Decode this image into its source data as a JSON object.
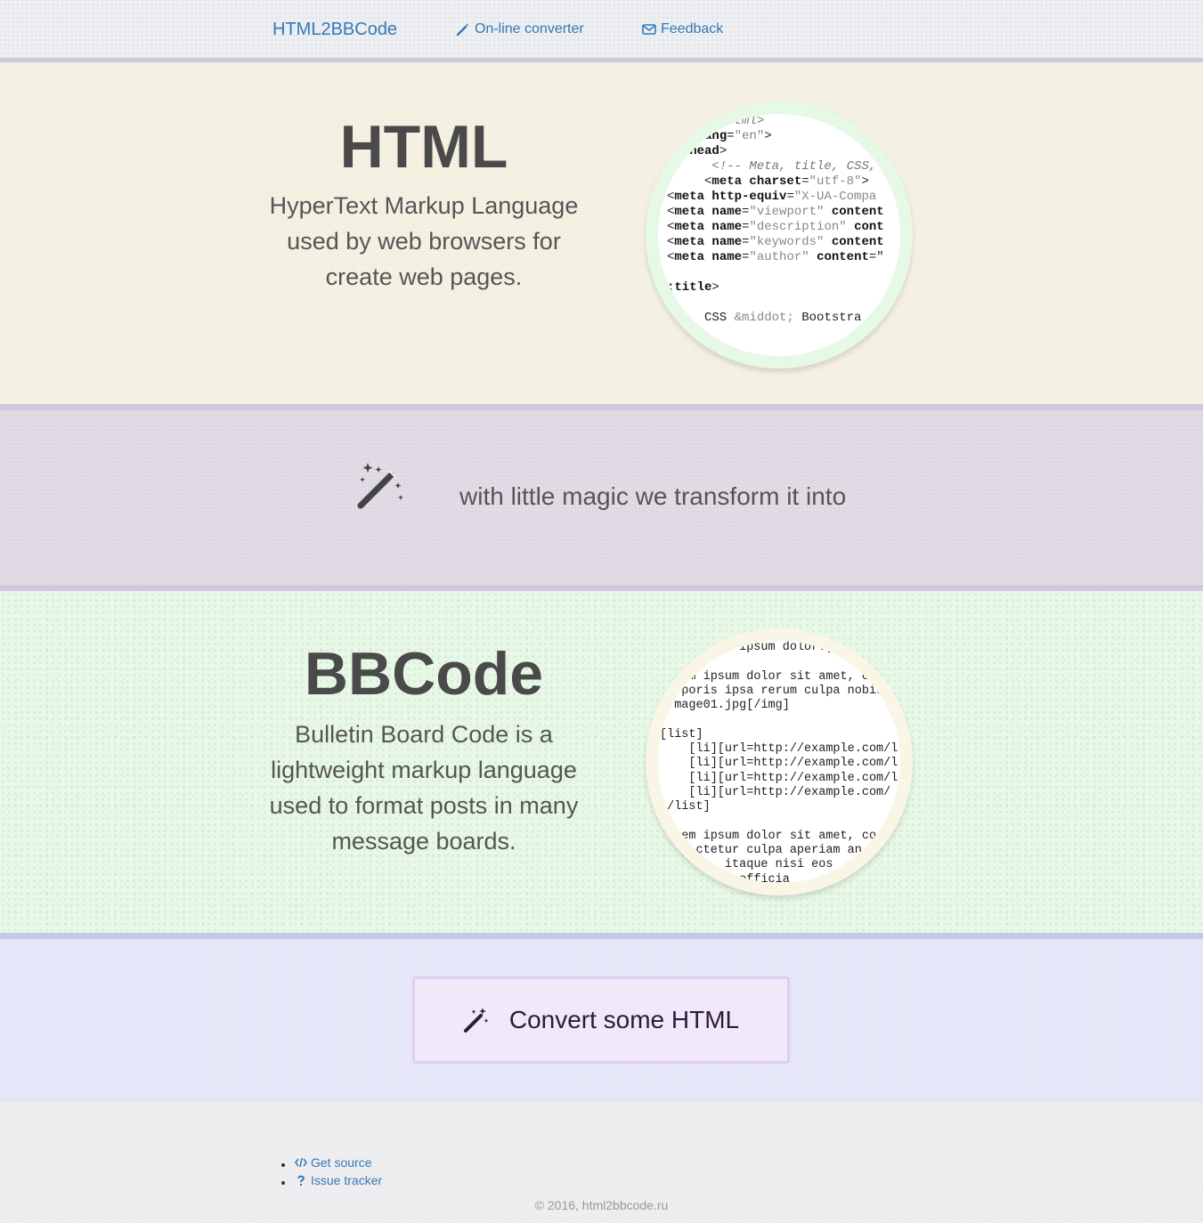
{
  "nav": {
    "brand": "HTML2BBCode",
    "converter_label": "On-line converter",
    "converter_icon": "magic-wand-icon",
    "feedback_label": "Feedback",
    "feedback_icon": "envelope-icon"
  },
  "html_section": {
    "title": "HTML",
    "description": "HyperText Markup Language used by web browsers for create web pages."
  },
  "magic_section": {
    "icon": "magic-wand-icon",
    "text": "with little magic we transform it into"
  },
  "bbcode_section": {
    "title": "BBCode",
    "description": "Bulletin Board Code is a lightweight markup language used to format posts in many message boards."
  },
  "cta": {
    "icon": "magic-wand-icon",
    "label": "Convert some HTML"
  },
  "footer": {
    "links": [
      {
        "icon": "code-icon",
        "label": "Get source"
      },
      {
        "icon": "question-icon",
        "label": "Issue tracker"
      }
    ],
    "copyright": "© 2016, html2bbcode.ru"
  },
  "colors": {
    "link": "#337ab7",
    "html_bg": "#f6f3e4",
    "magic_bg": "#e2dce7",
    "bbcode_bg": "#e7f9e6",
    "cta_bg": "#e6e7f8",
    "button_bg": "#f1e8fa"
  }
}
